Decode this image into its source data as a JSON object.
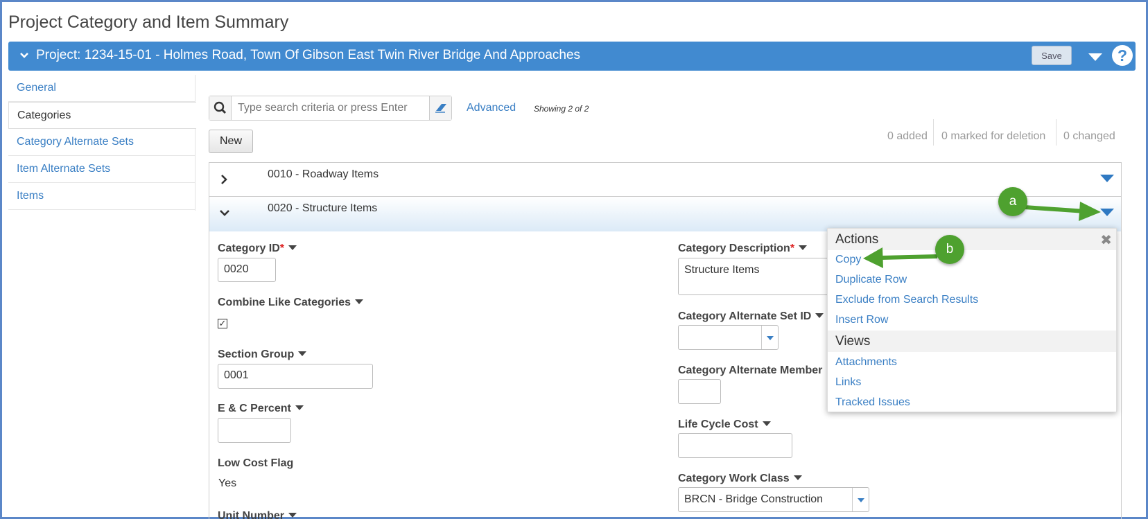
{
  "page": {
    "title": "Project Category and Item Summary"
  },
  "project_bar": {
    "title": "Project: 1234-15-01 - Holmes Road, Town Of Gibson East Twin River Bridge And Approaches",
    "save_label": "Save",
    "help_label": "?"
  },
  "sidebar": {
    "items": [
      {
        "label": "General"
      },
      {
        "label": "Categories"
      },
      {
        "label": "Category Alternate Sets"
      },
      {
        "label": "Item Alternate Sets"
      },
      {
        "label": "Items"
      }
    ]
  },
  "search": {
    "placeholder": "Type search criteria or press Enter",
    "advanced_label": "Advanced",
    "showing": "Showing 2 of 2"
  },
  "toolbar": {
    "new_label": "New",
    "added": "0 added",
    "marked": "0 marked for deletion",
    "changed": "0 changed"
  },
  "rows": [
    {
      "label": "0010 - Roadway Items"
    },
    {
      "label": "0020 - Structure Items"
    }
  ],
  "form": {
    "category_id": {
      "label": "Category ID",
      "value": "0020"
    },
    "combine": {
      "label": "Combine Like Categories",
      "checked": "✓"
    },
    "section_group": {
      "label": "Section Group",
      "value": "0001"
    },
    "ec_percent": {
      "label": "E & C Percent",
      "value": ""
    },
    "low_cost": {
      "label": "Low Cost Flag",
      "value": "Yes"
    },
    "unit_number": {
      "label": "Unit Number"
    },
    "category_description": {
      "label": "Category Description",
      "value": "Structure Items"
    },
    "alt_set_id": {
      "label": "Category Alternate Set ID",
      "value": ""
    },
    "alt_member": {
      "label": "Category Alternate Member",
      "value": ""
    },
    "life_cycle": {
      "label": "Life Cycle Cost",
      "value": ""
    },
    "work_class": {
      "label": "Category Work Class",
      "value": "BRCN - Bridge Construction"
    }
  },
  "menu": {
    "actions_header": "Actions",
    "actions": [
      "Copy",
      "Duplicate Row",
      "Exclude from Search Results",
      "Insert Row"
    ],
    "views_header": "Views",
    "views": [
      "Attachments",
      "Links",
      "Tracked Issues"
    ]
  },
  "callouts": {
    "a": "a",
    "b": "b"
  },
  "colors": {
    "accent": "#418ad0",
    "link": "#3a7fc4",
    "callout": "#4ea12f"
  }
}
